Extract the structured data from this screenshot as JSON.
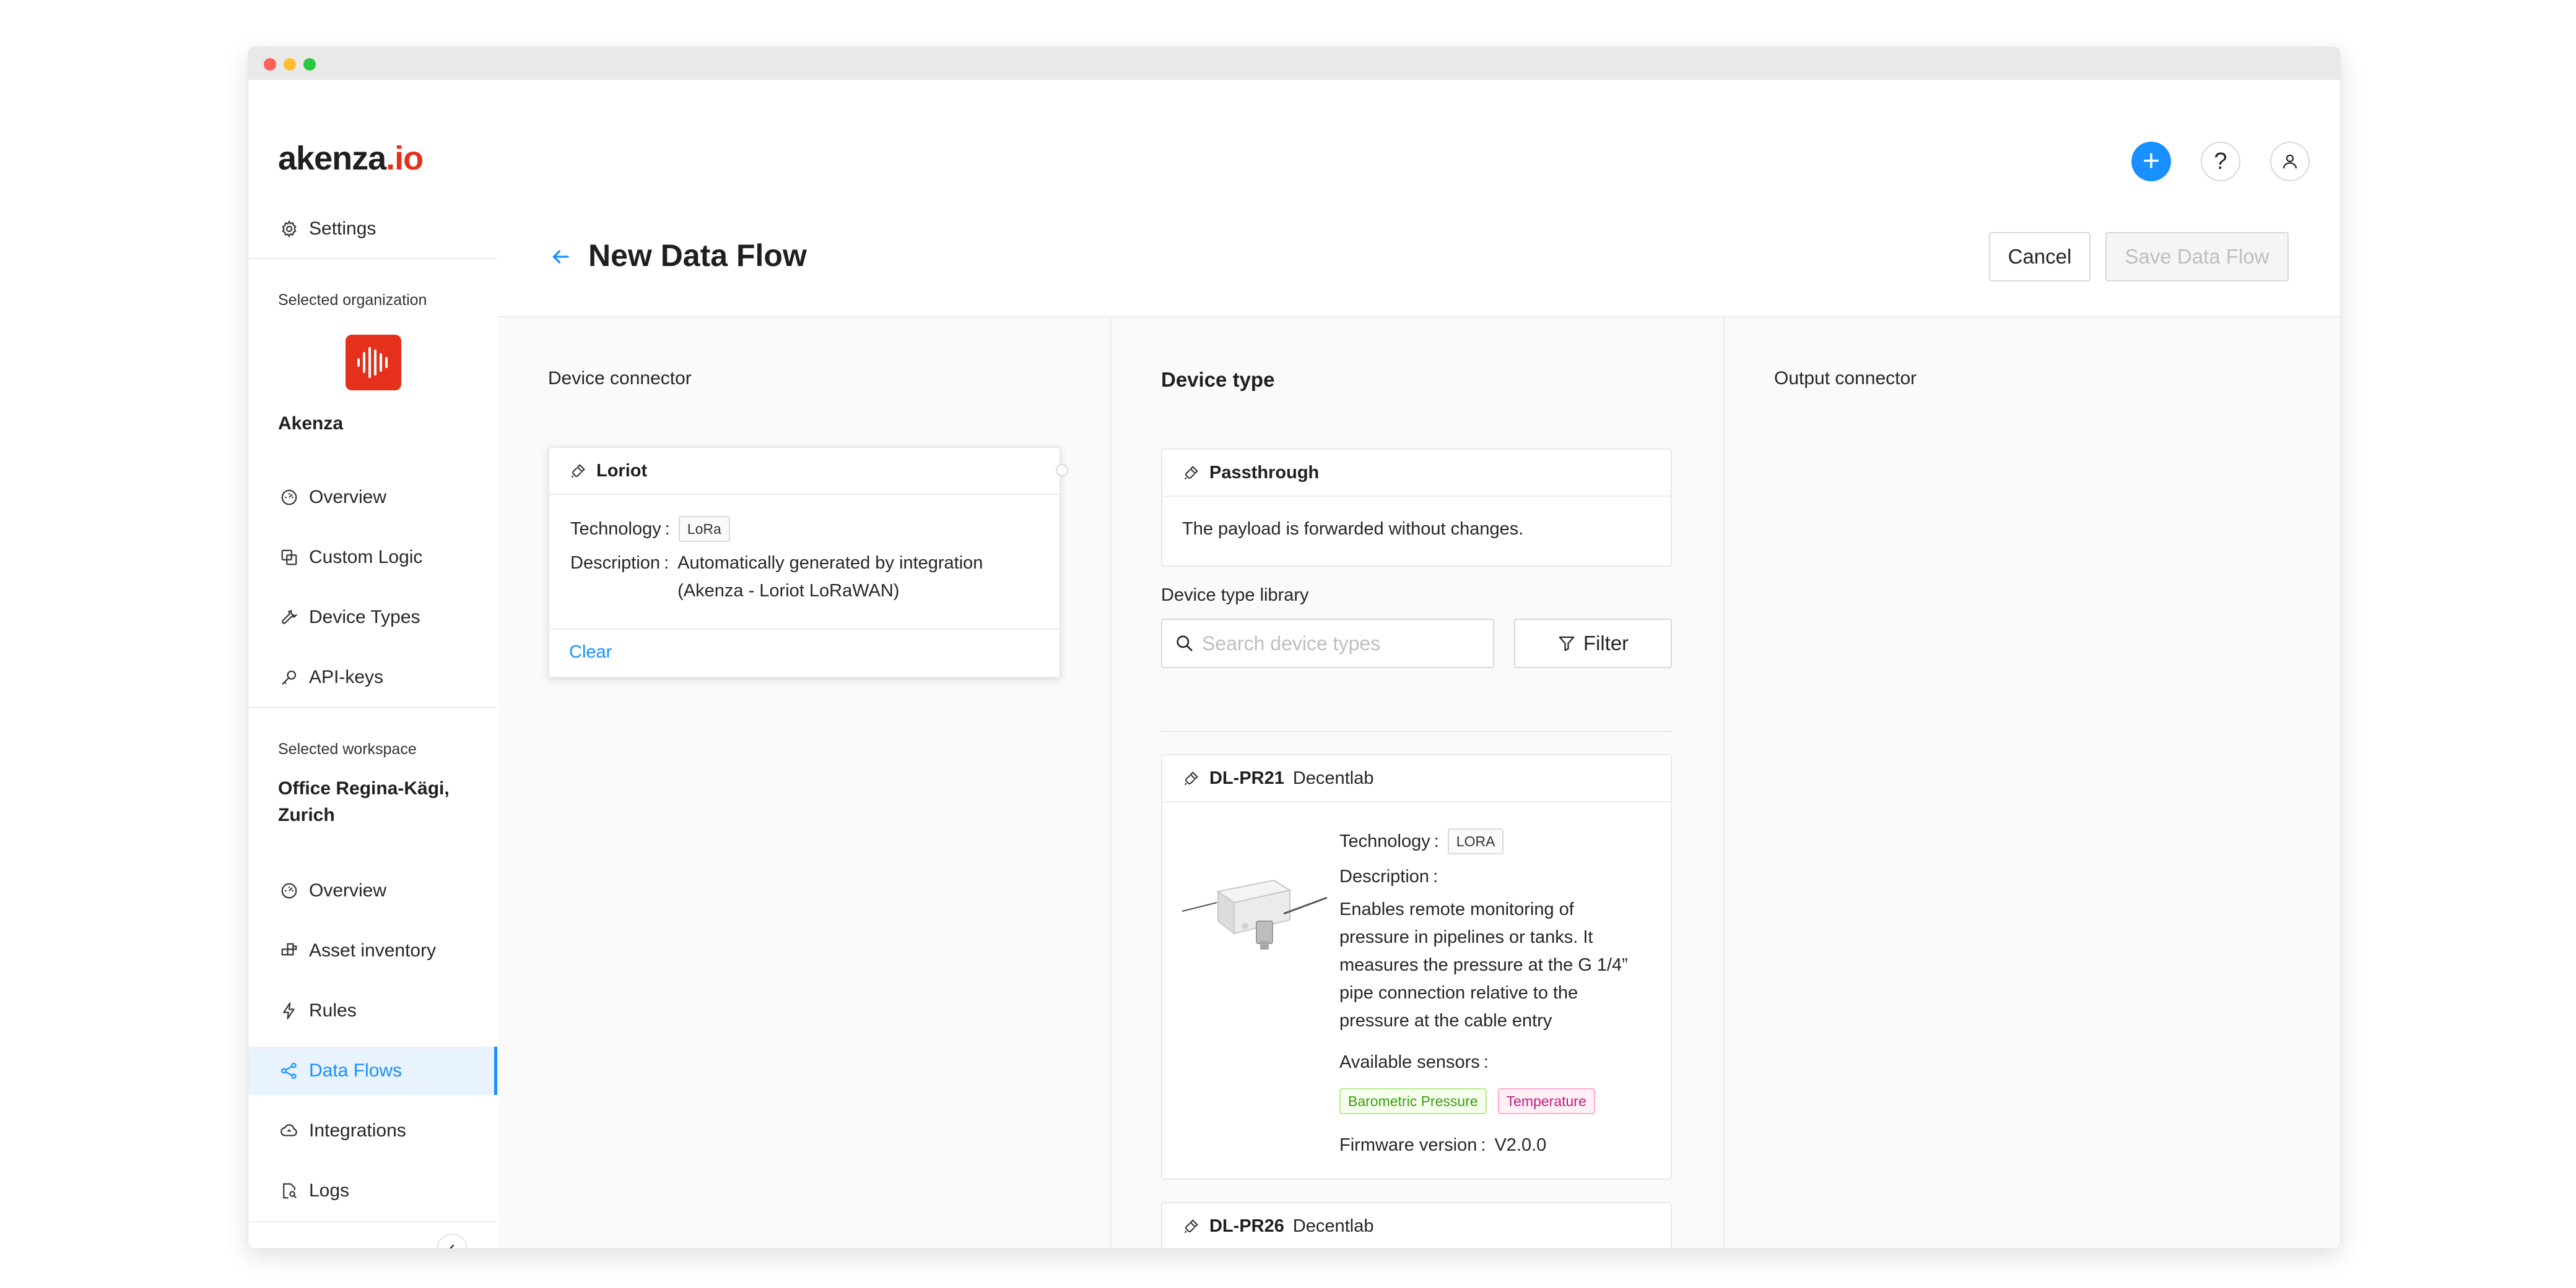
{
  "app": {
    "logo_main": "akenza",
    "logo_suffix": ".io"
  },
  "topbar": {
    "plus_label": "+",
    "help_label": "?"
  },
  "sidebar": {
    "settings_label": "Settings",
    "org_caption": "Selected organization",
    "org_name": "Akenza",
    "org_items": [
      {
        "label": "Overview",
        "icon": "dashboard-icon"
      },
      {
        "label": "Custom Logic",
        "icon": "copy-icon"
      },
      {
        "label": "Device Types",
        "icon": "tool-icon"
      },
      {
        "label": "API-keys",
        "icon": "key-icon"
      }
    ],
    "ws_caption": "Selected workspace",
    "ws_name_line1": "Office Regina-Kägi,",
    "ws_name_line2": "Zurich",
    "ws_items": [
      {
        "label": "Overview",
        "icon": "dashboard-icon"
      },
      {
        "label": "Asset inventory",
        "icon": "assets-icon"
      },
      {
        "label": "Rules",
        "icon": "thunderbolt-icon"
      },
      {
        "label": "Data Flows",
        "icon": "share-icon",
        "active": true
      },
      {
        "label": "Integrations",
        "icon": "cloud-sync-icon"
      },
      {
        "label": "Logs",
        "icon": "file-search-icon"
      }
    ]
  },
  "page": {
    "title": "New Data Flow",
    "cancel_label": "Cancel",
    "save_label": "Save Data Flow"
  },
  "device_connector": {
    "heading": "Device connector",
    "card": {
      "name": "Loriot",
      "technology_label": "Technology",
      "technology_value": "LoRa",
      "description_label": "Description",
      "description_line1": "Automatically generated by integration",
      "description_line2": "(Akenza - Loriot LoRaWAN)",
      "clear_label": "Clear"
    }
  },
  "device_type": {
    "heading": "Device type",
    "passthrough": {
      "name": "Passthrough",
      "text": "The payload is forwarded without changes."
    },
    "library_label": "Device type library",
    "search_placeholder": "Search device types",
    "filter_label": "Filter",
    "devices": [
      {
        "name": "DL-PR21",
        "vendor": "Decentlab",
        "technology_label": "Technology",
        "technology_value": "LORA",
        "description_label": "Description",
        "description_lines": [
          "Enables remote monitoring of",
          "pressure in pipelines or tanks. It",
          "measures the pressure at the G 1/4”",
          "pipe connection relative to the",
          "pressure at the cable entry"
        ],
        "sensors_label": "Available sensors",
        "sensors": [
          "Barometric Pressure",
          "Temperature"
        ],
        "firmware_label": "Firmware version",
        "firmware_value": "V2.0.0"
      },
      {
        "name": "DL-PR26",
        "vendor": "Decentlab"
      }
    ]
  },
  "output_connector": {
    "heading": "Output connector"
  },
  "colors": {
    "accent": "#1890ff",
    "brand": "#e5311b",
    "sensor_green": "#389e0d",
    "sensor_pink": "#c41d7f"
  }
}
